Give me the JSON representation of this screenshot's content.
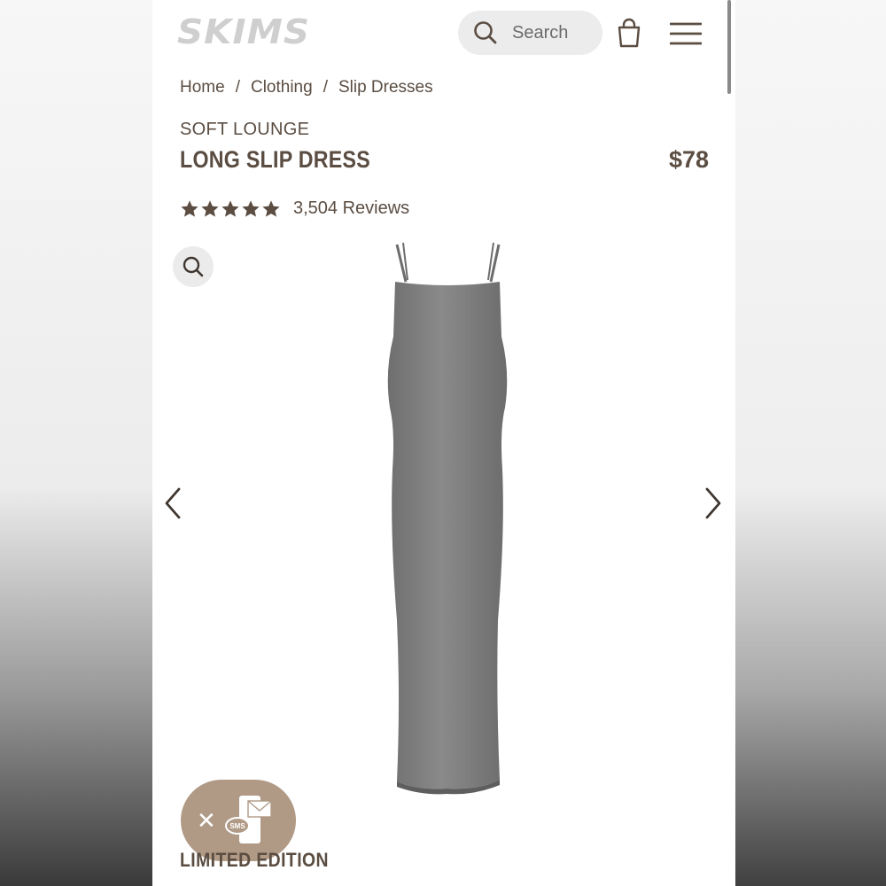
{
  "brand": {
    "logo_text": "SKIMS"
  },
  "header": {
    "search_placeholder": "Search"
  },
  "breadcrumb": [
    "Home",
    "Clothing",
    "Slip Dresses"
  ],
  "product": {
    "collection": "SOFT LOUNGE",
    "name": "LONG SLIP DRESS",
    "price": "$78",
    "rating": 5,
    "reviews": "3,504 Reviews"
  },
  "below_fold": {
    "badge": "LIMITED EDITION"
  },
  "sms": {
    "label": "SMS"
  },
  "colors": {
    "brand_text": "#5b4d42",
    "logo": "#cfcfcf",
    "sms_pill": "#b09a86",
    "dress": "#7a7a7a"
  },
  "icons": [
    "search-icon",
    "bag-icon",
    "menu-icon",
    "star-icon",
    "zoom-icon",
    "chevron-left-icon",
    "chevron-right-icon",
    "close-icon",
    "sms-icon"
  ]
}
